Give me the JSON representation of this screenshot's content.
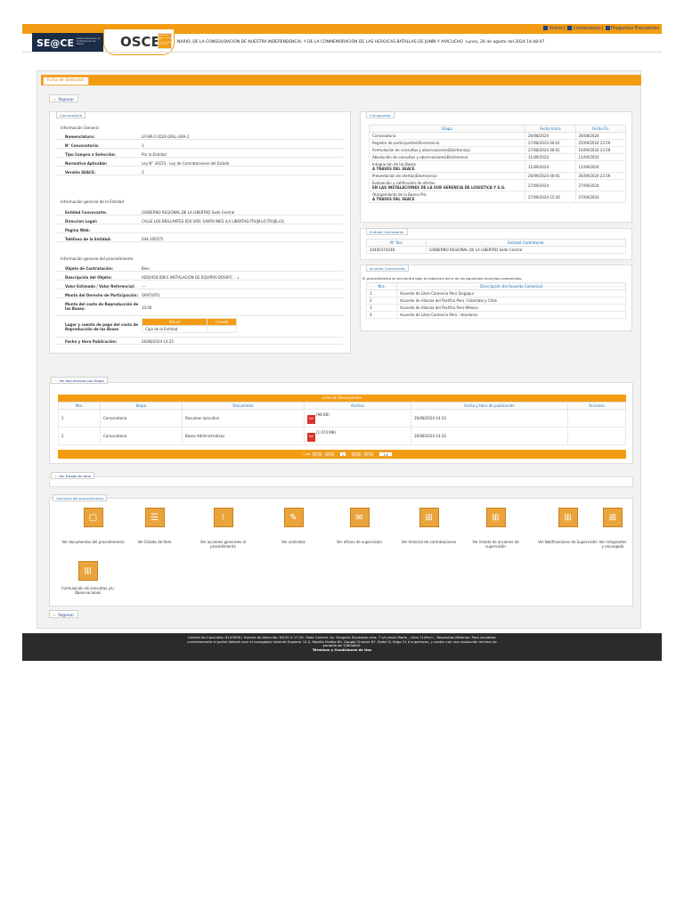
{
  "header": {
    "links": [
      "Volver",
      "Contactenos",
      "Preguntas Frecuentes"
    ],
    "seace_logo": "SE@CE",
    "seace_sub": "Sistema Electrónico de Contrataciones del Estado",
    "osce_logo": "OSCE",
    "osce_sub": "Organismo Supervisor de las Contrataciones del Estado",
    "headline": "NARIO, DE LA CONSOLIDACIÓN DE NUESTRA INDEPENDENCIA, Y DE LA CONMEMORACIÓN DE LAS HEROICAS BATALLAS DE JUNÍN Y AYACUCHO",
    "date": "Lunes, 26 de agosto del 2024 14:48:07"
  },
  "tab": "Ficha de Seleccion",
  "regresar": "Regresar",
  "convocatoria": {
    "label": "Convocatoria",
    "general_title": "Información General",
    "general": [
      {
        "k": "Nomenclatura:",
        "v": "LP-SM-2-2024-GRLL-GRA-1"
      },
      {
        "k": "N° Convocatoria:",
        "v": "1"
      },
      {
        "k": "Tipo Compra o Selección:",
        "v": "Por la Entidad"
      },
      {
        "k": "Normativa Aplicable:",
        "v": "Ley N° 30225 - Ley de Contrataciones del Estado"
      },
      {
        "k": "Versión SEACE:",
        "v": "3"
      }
    ],
    "entidad_title": "Información general de la Entidad",
    "entidad": [
      {
        "k": "Entidad Convocante:",
        "v": "GOBIERNO REGIONAL DE LA LIBERTAD Sede Central"
      },
      {
        "k": "Direccion Legal:",
        "v": "CALLE LOS BRILLANTES 650 URB. SANTA INES (LA LIBERTAD-TRUJILLO-TRUJILLO)"
      },
      {
        "k": "Pagina Web:",
        "v": ""
      },
      {
        "k": "Teléfono de la Entidad:",
        "v": "044-200575"
      }
    ],
    "proc_title": "Información general del procedimiento",
    "proc": [
      {
        "k": "Objeto de Contratación:",
        "v": "Bien"
      },
      {
        "k": "Descripción del Objeto:",
        "v": "ADQUISICION E INSTALACION DE EQUIPOS DOSIFIC..."
      },
      {
        "k": "Valor Estimado / Valor Referencial:",
        "v": "---"
      },
      {
        "k": "Monto del Derecho de Participación:",
        "v": "GRATUITO"
      },
      {
        "k": "Monto del costo de Reproducción de las Bases:",
        "v": "10.00"
      }
    ],
    "pago_label": "Lugar y cuenta de pago del costo de Reproducción de las Bases",
    "pago_headers": [
      "Banco",
      "Cuenta"
    ],
    "pago_row": [
      "Caja de la Entidad",
      ""
    ],
    "pub_label": "Fecha y Hora Publicación:",
    "pub_value": "26/08/2024 14:33"
  },
  "cronograma": {
    "label": "Cronograma",
    "headers": [
      "Etapa",
      "Fecha Inicio",
      "Fecha Fin"
    ],
    "rows": [
      {
        "etapa": "Convocatoria",
        "sub": "",
        "ini": "26/08/2024",
        "fin": "26/08/2024"
      },
      {
        "etapa": "Registro de participantes(Electronica)",
        "sub": "",
        "ini": "27/08/2024 00:01",
        "fin": "25/09/2024 23:59"
      },
      {
        "etapa": "Formulación de consultas y observaciones(Electronica)",
        "sub": "",
        "ini": "27/08/2024 00:01",
        "fin": "10/09/2024 23:59"
      },
      {
        "etapa": "Absolución de consultas y observaciones(Electronica)",
        "sub": "",
        "ini": "11/09/2024",
        "fin": "11/09/2024"
      },
      {
        "etapa": "Integración de las Bases",
        "sub": "A TRAVES DEL SEACE",
        "ini": "11/09/2024",
        "fin": "11/09/2024"
      },
      {
        "etapa": "Presentación de ofertas(Electronica)",
        "sub": "",
        "ini": "26/09/2024 00:01",
        "fin": "26/09/2024 23:59"
      },
      {
        "etapa": "Evaluación y calificación de ofertas",
        "sub": "EN LAS INSTALACIONES DE LA SUB GERENCIA DE LOGISTICA Y S.G.",
        "ini": "27/09/2024",
        "fin": "27/09/2024"
      },
      {
        "etapa": "Otorgamiento de la Buena Pro",
        "sub": "A TRAVES DEL SEACE",
        "ini": "27/09/2024 15:30",
        "fin": "27/09/2024"
      }
    ]
  },
  "entidad_contratante": {
    "label": "Entidad Contratante",
    "headers": [
      "N° Ruc",
      "Entidad Contratante"
    ],
    "ruc": "20440374248",
    "nombre": "GOBIERNO REGIONAL DE LA LIBERTAD Sede Central"
  },
  "acuerdos": {
    "label": "Acuerdo Comerciales",
    "intro": "El procedimiento se encuentra bajo la cobertura del o de los siguientes acuerdos comerciales:",
    "headers": [
      "Nro.",
      "Descripción del Acuerdo Comercial"
    ],
    "rows": [
      {
        "n": "1",
        "d": "Acuerdo de Libre Comercio Perú Singapur"
      },
      {
        "n": "2",
        "d": "Acuerdo de Alianza del Pacífico Perú -Colombia y Chile"
      },
      {
        "n": "3",
        "d": "Acuerdo de Alianza del Pacífico Perú-México"
      },
      {
        "n": "4",
        "d": "Acuerdo de Libre Comercio Perú - Honduras"
      }
    ]
  },
  "documentos": {
    "toggle": "Ver documentos por Etapa",
    "title": "Lista de Documentos",
    "headers": [
      "Nro.",
      "Etapa",
      "Documento",
      "Archivo",
      "Fecha y Hora de publicación",
      "Acciones"
    ],
    "rows": [
      {
        "n": "1",
        "etapa": "Convocatoria",
        "doc": "Resumen ejecutivo",
        "size": "(98 KB)",
        "fecha": "26/08/2024 14:33"
      },
      {
        "n": "2",
        "etapa": "Convocatoria",
        "doc": "Bases Administrativas",
        "size": "(1.074 MB)",
        "fecha": "26/08/2024 14:33"
      }
    ],
    "pager": {
      "info": "1 de 1",
      "page": "1",
      "per_page": "5"
    }
  },
  "ver_estado": "Ver Estado de Item",
  "opciones": {
    "label": "Opciones del procedimiento",
    "items": [
      {
        "label": "Ver documentos del procedimiento",
        "icon": "document-copy-icon"
      },
      {
        "label": "Ver Estado de Item",
        "icon": "list-icon"
      },
      {
        "label": "Ver acciones generales al procedimiento",
        "icon": "traffic-light-icon"
      },
      {
        "label": "Ver contratos",
        "icon": "contract-icon"
      },
      {
        "label": "Ver oficios de supervisión",
        "icon": "envelope-icon"
      },
      {
        "label": "Ver historial de contrataciones",
        "icon": "flowchart-icon"
      },
      {
        "label": "Ver listado de acciones de supervisión",
        "icon": "flowchart-icon"
      },
      {
        "label": "Ver Notificaciones de Supervisión",
        "icon": "flowchart-icon"
      },
      {
        "label": "Ver integrantes y encargado",
        "icon": "flowchart-icon"
      },
      {
        "label": "Formulación de consultas y/u Observaciones",
        "icon": "flowchart-icon"
      }
    ]
  },
  "footer": {
    "line1": "Central de Consultas: 6143636 | Horario de Atención: 08:30 A 17:30. Sede Central: Av. Gregorio Escobedo cdra. 7 s/n Jesús María - Lima 11/Perú... Requisitos Mínimos: Para visualizar",
    "line2": "correctamente el portal deberá usar el navegador Internet Explorer 11.0, Mozilla Firefox 60, Google Chrome 67, Safari 8, Edge 21 ó superiores, y contar con una resolución mínima de",
    "line3": "pantalla de 1280x800.",
    "terms": "Términos y Condiciones de Uso"
  }
}
